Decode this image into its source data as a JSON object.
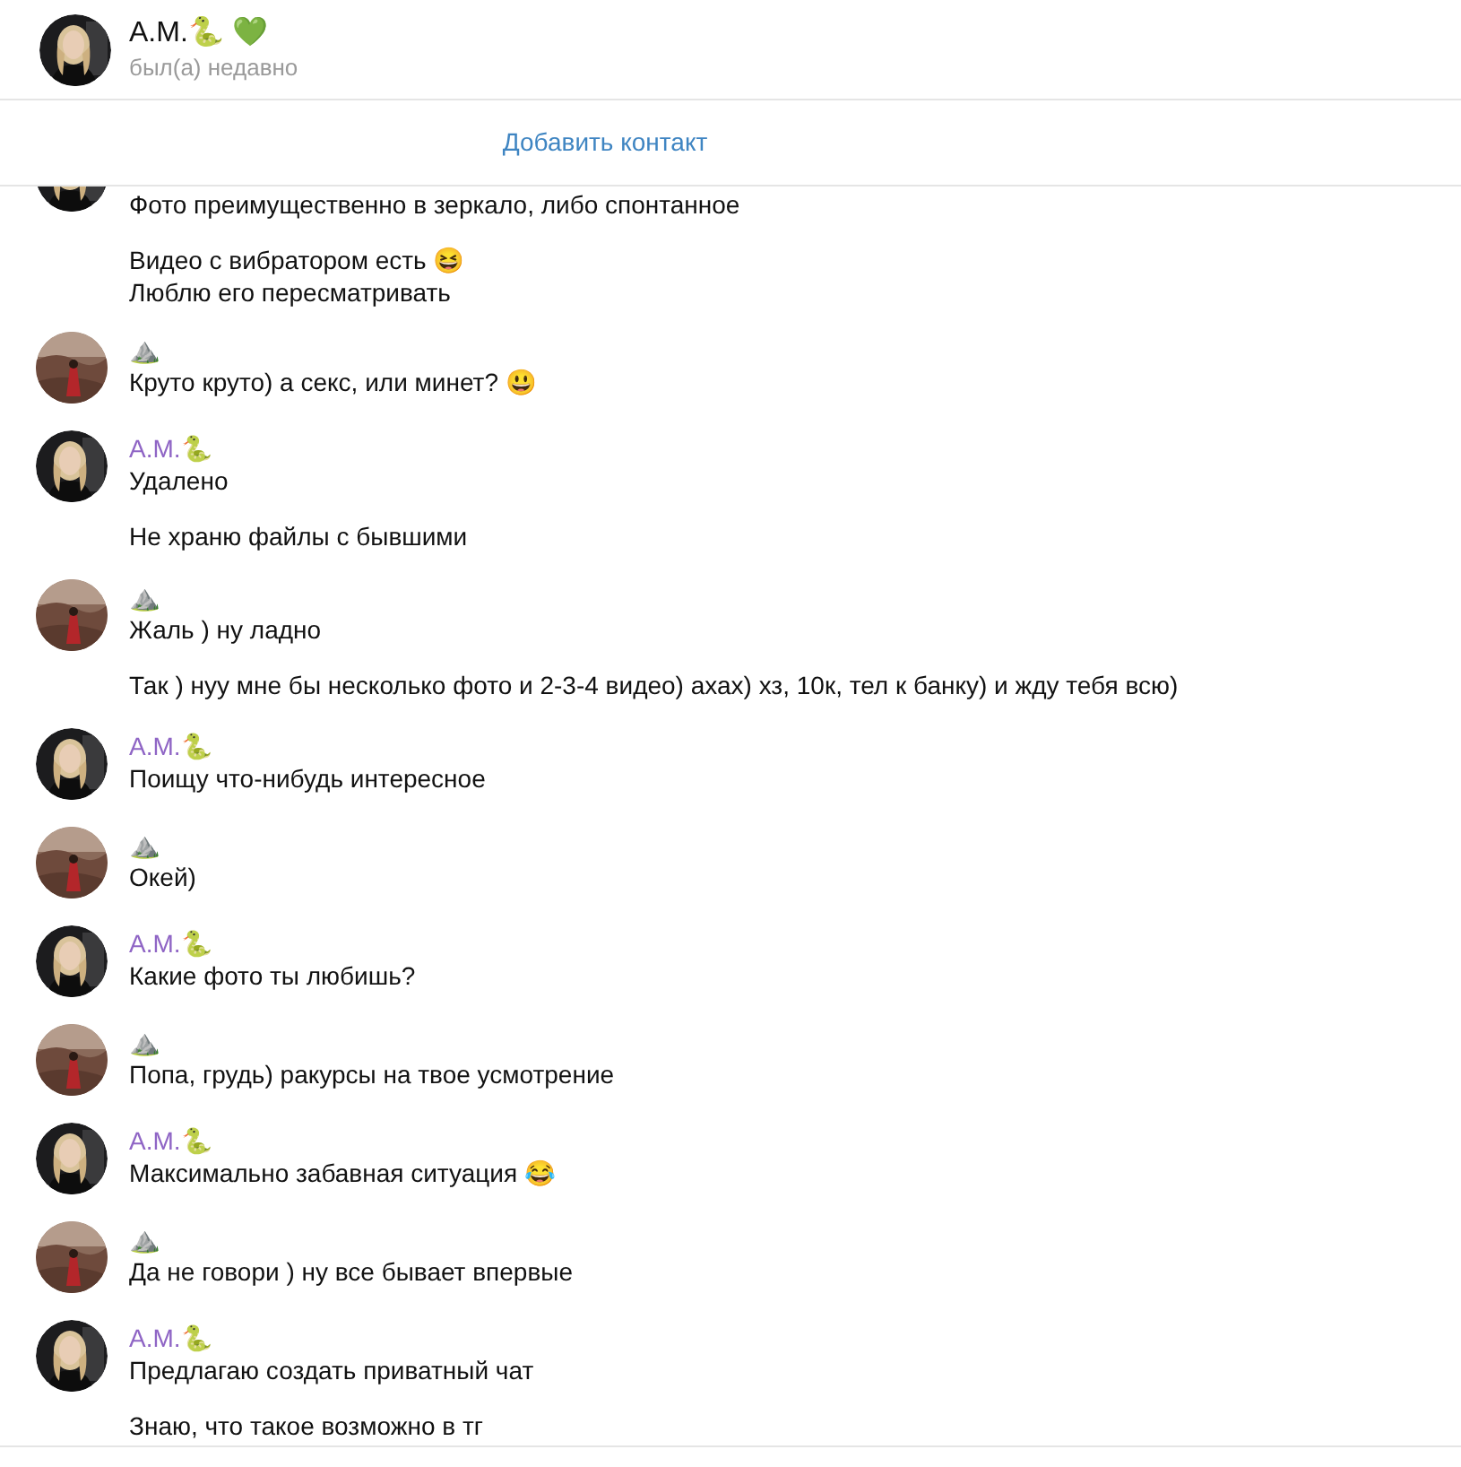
{
  "header": {
    "name": "А.М.🐍 💚",
    "status": "был(а) недавно"
  },
  "add_contact": "Добавить контакт",
  "groups": [
    {
      "kind": "contact",
      "cut": true,
      "messages": [
        "Фото преимущественно в зеркало, либо спонтанное",
        "Видео с вибратором есть 😆\nЛюблю его пересматривать"
      ]
    },
    {
      "kind": "me",
      "name": "⛰️",
      "messages": [
        "Круто круто) а секс, или минет? 😃"
      ]
    },
    {
      "kind": "contact",
      "name": "А.М.🐍",
      "messages": [
        "Удалено",
        "Не храню файлы с бывшими"
      ]
    },
    {
      "kind": "me",
      "name": "⛰️",
      "messages": [
        "Жаль ) ну ладно",
        "Так ) нуу мне бы несколько фото и 2-3-4 видео) ахах) хз, 10к, тел к банку) и жду тебя всю)"
      ]
    },
    {
      "kind": "contact",
      "name": "А.М.🐍",
      "messages": [
        "Поищу что-нибудь интересное"
      ]
    },
    {
      "kind": "me",
      "name": "⛰️",
      "messages": [
        "Окей)"
      ]
    },
    {
      "kind": "contact",
      "name": "А.М.🐍",
      "messages": [
        "Какие фото ты любишь?"
      ]
    },
    {
      "kind": "me",
      "name": "⛰️",
      "messages": [
        "Попа, грудь) ракурсы на твое усмотрение"
      ]
    },
    {
      "kind": "contact",
      "name": "А.М.🐍",
      "messages": [
        "Максимально забавная ситуация 😂"
      ]
    },
    {
      "kind": "me",
      "name": "⛰️",
      "messages": [
        "Да не говори ) ну все бывает впервые"
      ]
    },
    {
      "kind": "contact",
      "name": "А.М.🐍",
      "messages": [
        "Предлагаю создать приватный чат",
        "Знаю, что такое возможно в тг"
      ]
    }
  ]
}
